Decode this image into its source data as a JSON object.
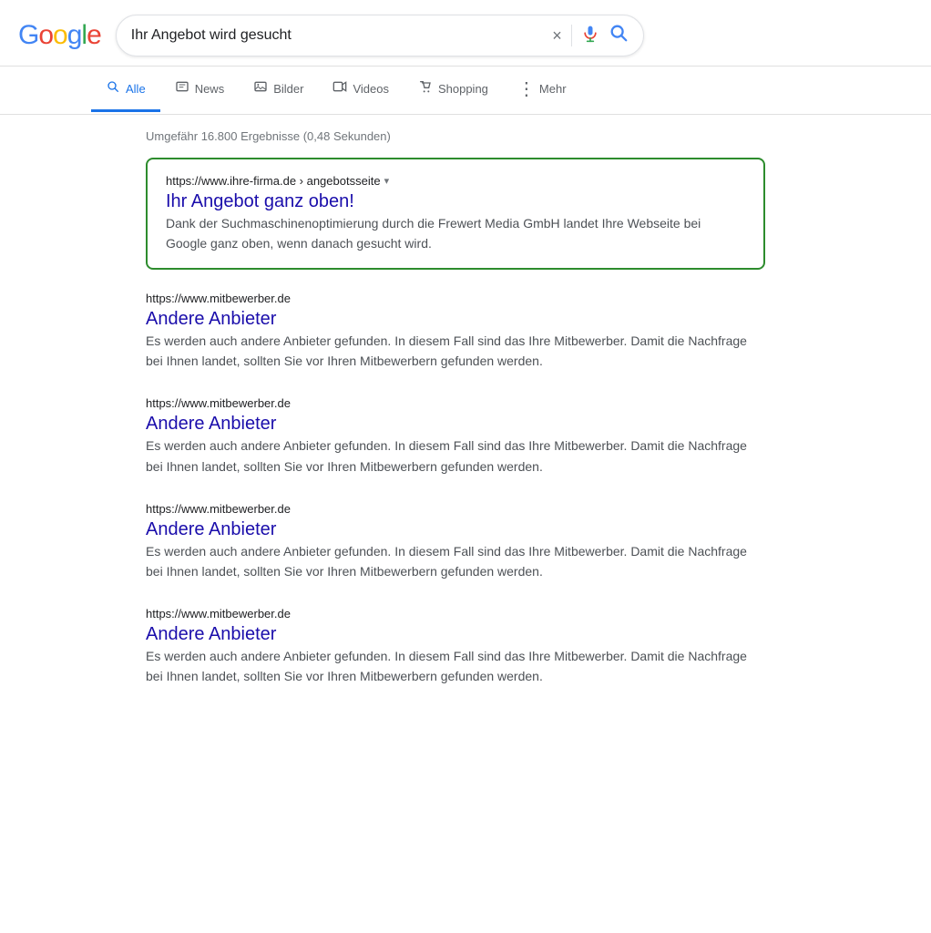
{
  "header": {
    "logo": {
      "g1": "G",
      "o1": "o",
      "o2": "o",
      "g2": "g",
      "l": "l",
      "e": "e"
    },
    "search_query": "Ihr Angebot wird gesucht",
    "clear_button": "×",
    "mic_label": "mic-icon",
    "search_button_label": "search-icon"
  },
  "nav": {
    "tabs": [
      {
        "id": "alle",
        "label": "Alle",
        "icon": "🔍",
        "active": true
      },
      {
        "id": "news",
        "label": "News",
        "icon": "📰",
        "active": false
      },
      {
        "id": "bilder",
        "label": "Bilder",
        "icon": "🖼",
        "active": false
      },
      {
        "id": "videos",
        "label": "Videos",
        "icon": "▶",
        "active": false
      },
      {
        "id": "shopping",
        "label": "Shopping",
        "icon": "◇",
        "active": false
      },
      {
        "id": "mehr",
        "label": "Mehr",
        "icon": "⋮",
        "active": false
      }
    ]
  },
  "results": {
    "stats": "Umgefähr 16.800 Ergebnisse (0,48 Sekunden)",
    "featured": {
      "url": "https://www.ihre-firma.de › angebotsseite",
      "title": "Ihr Angebot ganz oben!",
      "snippet": "Dank der Suchmaschinenoptimierung durch die Frewert Media GmbH landet Ihre Webseite bei Google ganz oben, wenn danach gesucht wird."
    },
    "items": [
      {
        "url": "https://www.mitbewerber.de",
        "title": "Andere Anbieter",
        "snippet": "Es werden auch andere Anbieter gefunden. In diesem Fall sind das Ihre Mitbewerber. Damit die Nachfrage bei Ihnen landet, sollten Sie vor Ihren Mitbewerbern gefunden werden."
      },
      {
        "url": "https://www.mitbewerber.de",
        "title": "Andere Anbieter",
        "snippet": "Es werden auch andere Anbieter gefunden. In diesem Fall sind das Ihre Mitbewerber. Damit die Nachfrage bei Ihnen landet, sollten Sie vor Ihren Mitbewerbern gefunden werden."
      },
      {
        "url": "https://www.mitbewerber.de",
        "title": "Andere Anbieter",
        "snippet": "Es werden auch andere Anbieter gefunden. In diesem Fall sind das Ihre Mitbewerber. Damit die Nachfrage bei Ihnen landet, sollten Sie vor Ihren Mitbewerbern gefunden werden."
      },
      {
        "url": "https://www.mitbewerber.de",
        "title": "Andere Anbieter",
        "snippet": "Es werden auch andere Anbieter gefunden. In diesem Fall sind das Ihre Mitbewerber. Damit die Nachfrage bei Ihnen landet, sollten Sie vor Ihren Mitbewerbern gefunden werden."
      }
    ]
  },
  "colors": {
    "google_blue": "#4285F4",
    "google_red": "#EA4335",
    "google_yellow": "#FBBC05",
    "google_green": "#34A853",
    "featured_border": "#2d8c2d",
    "link_color": "#1a0dab",
    "url_color": "#202124",
    "snippet_color": "#4d5156",
    "meta_color": "#70757a"
  }
}
